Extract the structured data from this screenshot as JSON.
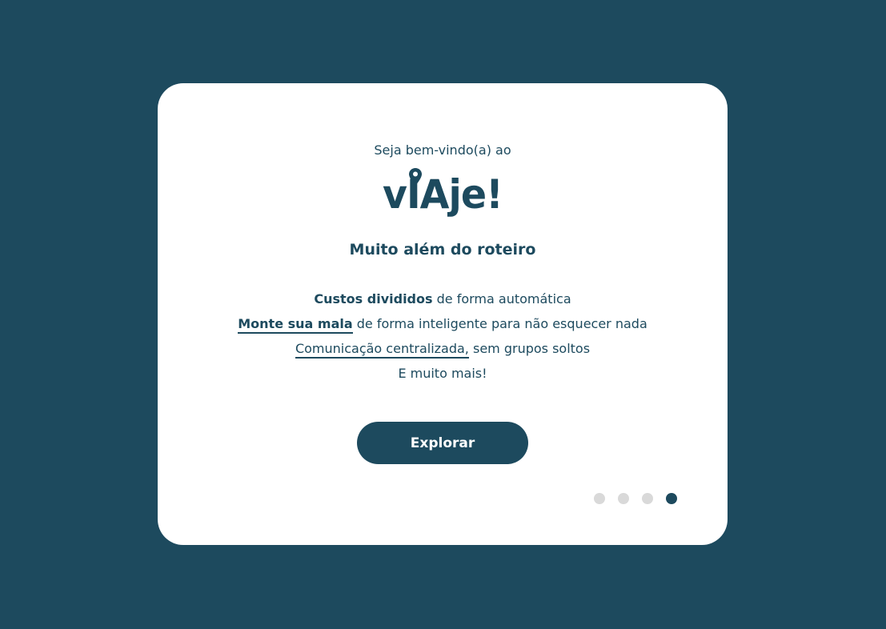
{
  "colors": {
    "background": "#1d4a5e",
    "card": "#ffffff",
    "accent": "#1d4a5e",
    "dot_inactive": "#d9d9d9"
  },
  "welcome": {
    "greeting": "Seja bem-vindo(a) ao",
    "logo_text": "vIAje!",
    "logo_icon": "location-pin-icon",
    "tagline": "Muito além do roteiro"
  },
  "features": [
    {
      "highlight": "Custos divididos",
      "rest": " de forma automática"
    },
    {
      "highlight": "Monte sua mala",
      "rest": " de forma inteligente para não esquecer nada"
    },
    {
      "highlight": "Comunicação centralizada,",
      "rest": " sem grupos soltos"
    },
    {
      "highlight": "",
      "rest": "E muito mais!"
    }
  ],
  "cta": {
    "explore_label": "Explorar"
  },
  "pagination": {
    "total": 4,
    "current": 4
  }
}
